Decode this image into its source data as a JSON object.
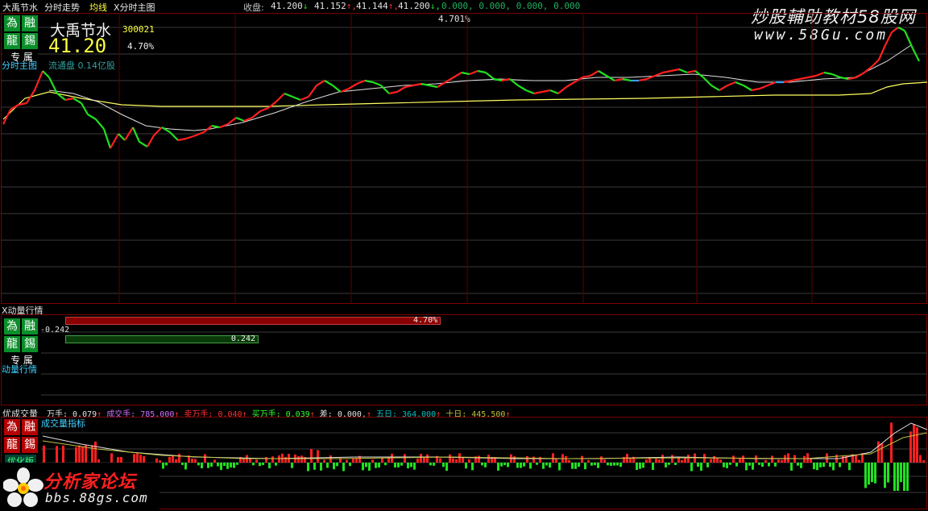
{
  "window_title": "大禹节水",
  "top_bar": {
    "tab_trend": "分时走势",
    "tab_avg": "均线",
    "tab_main": "X分时主图",
    "readout_label": "收盘:",
    "readout_values": [
      "41.200",
      "41.152",
      "41.144",
      "41.200"
    ],
    "readout_tail": "0.000, 0.000, 0.000, 0.000",
    "pct_label": "4.701%"
  },
  "watermark_top": {
    "line1": "炒股輔助教材58股网",
    "line2": "www.58Gu.com"
  },
  "watermark_bottom": {
    "line1": "分析家论坛",
    "line2": "bbs.88gs.com"
  },
  "badge": {
    "c1": "為",
    "c2": "融",
    "c3": "龍",
    "c4": "錫",
    "caption": "专 属"
  },
  "main_panel": {
    "label": "分时主图",
    "stock_name": "大禹节水",
    "stock_code": "300021",
    "price": "41.20",
    "change_pct": "4.70%",
    "float_cap": "流通盘 0.14亿股"
  },
  "mid_panel": {
    "title": "X动量行情",
    "label": "动量行情",
    "neg_value": "-0.242",
    "red_bar_label": "4.70%",
    "red_bar_fraction": 0.61,
    "green_bar_label": "0.242",
    "green_bar_fraction": 0.314
  },
  "bottom_panel": {
    "title": "优成交量",
    "label": "成交量指标",
    "tag": "优化版",
    "readouts": [
      {
        "label": "万手:",
        "value": "0.079",
        "color": "#e0e0e0"
      },
      {
        "label": "成交手:",
        "value": "785.000",
        "color": "#d070ff"
      },
      {
        "label": "卖万手:",
        "value": "0.040",
        "color": "#ff3030"
      },
      {
        "label": "买万手:",
        "value": "0.039",
        "color": "#30ff30"
      },
      {
        "label": "差:",
        "value": "0.000,",
        "color": "#e0e0e0"
      },
      {
        "label": "五日:",
        "value": "364.000",
        "color": "#00c0c0"
      },
      {
        "label": "十日:",
        "value": "445.500",
        "color": "#c0c040"
      }
    ]
  },
  "colors": {
    "up": "#ff2020",
    "down": "#20e020",
    "flat": "#3aa0ff",
    "avg": "#ffff60",
    "ma": "#e8e8e8",
    "grid": "#3a3a3a",
    "frame": "#8a0000"
  }
}
